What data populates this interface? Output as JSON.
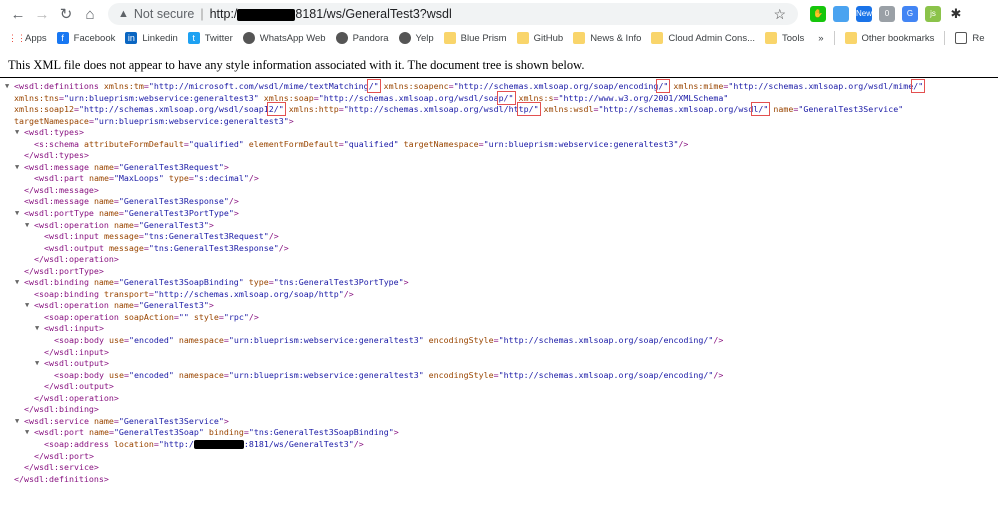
{
  "browser": {
    "address": {
      "security_label": "Not secure",
      "url_prefix": "http:/",
      "url_suffix": "8181/ws/GeneralTest3?wsdl"
    },
    "extensions": [
      {
        "name": "green-thumb",
        "color": "#16c60c",
        "text": "✋"
      },
      {
        "name": "window",
        "color": "#4aa3f0",
        "text": ""
      },
      {
        "name": "new-badge",
        "color": "#1a73e8",
        "text": "New"
      },
      {
        "name": "question",
        "color": "#9aa0a6",
        "text": "0"
      },
      {
        "name": "translate",
        "color": "#4285f4",
        "text": "G"
      },
      {
        "name": "js",
        "color": "#8bc34a",
        "text": "js"
      },
      {
        "name": "puzzle",
        "color": "#333",
        "text": "✱"
      }
    ],
    "bookmarks": [
      {
        "label": "Apps",
        "icon": "apps"
      },
      {
        "label": "Facebook",
        "icon": "facebook"
      },
      {
        "label": "Linkedin",
        "icon": "linkedin"
      },
      {
        "label": "Twitter",
        "icon": "twitter"
      },
      {
        "label": "WhatsApp Web",
        "icon": "globe"
      },
      {
        "label": "Pandora",
        "icon": "globe"
      },
      {
        "label": "Yelp",
        "icon": "globe"
      },
      {
        "label": "Blue Prism",
        "icon": "folder"
      },
      {
        "label": "GitHub",
        "icon": "folder"
      },
      {
        "label": "News & Info",
        "icon": "folder"
      },
      {
        "label": "Cloud Admin Cons...",
        "icon": "folder"
      },
      {
        "label": "Tools",
        "icon": "folder"
      }
    ],
    "overflow": "»",
    "other_bookmarks": "Other bookmarks",
    "reading_list": "Re"
  },
  "notice": "This XML file does not appear to have any style information associated with it. The document tree is shown below.",
  "lines": [
    {
      "i": 0,
      "x": 1,
      "s": [
        [
          "t",
          "<wsdl:definitions "
        ],
        [
          "a",
          "xmlns:tm"
        ],
        [
          "t",
          "="
        ],
        [
          "v",
          "\"http://microsoft.com/wsdl/mime/textMatching"
        ],
        [
          "m",
          "/\""
        ],
        [
          "a",
          " xmlns:soapenc"
        ],
        [
          "t",
          "="
        ],
        [
          "v",
          "\"http://schemas.xmlsoap.org/soap/encoding"
        ],
        [
          "m",
          "/\""
        ],
        [
          "a",
          " xmlns:mime"
        ],
        [
          "t",
          "="
        ],
        [
          "v",
          "\"http://schemas.xmlsoap.org/wsdl/mime"
        ],
        [
          "m",
          "/\""
        ]
      ]
    },
    {
      "i": 0,
      "s": [
        [
          "a",
          "xmlns:tns"
        ],
        [
          "t",
          "="
        ],
        [
          "v",
          "\"urn:blueprism:webservice:generaltest3\""
        ],
        [
          "a",
          " xmlns:soap"
        ],
        [
          "t",
          "="
        ],
        [
          "v",
          "\"http://schemas.xmlsoap.org/wsdl/soa"
        ],
        [
          "m",
          "p/\""
        ],
        [
          "a",
          " xmlns:s"
        ],
        [
          "t",
          "="
        ],
        [
          "v",
          "\"http://www.w3.org/2001/XMLSchema\""
        ]
      ]
    },
    {
      "i": 0,
      "s": [
        [
          "a",
          "xmlns:soap12"
        ],
        [
          "t",
          "="
        ],
        [
          "v",
          "\"http://schemas.xmlsoap.org/wsdl/soap1"
        ],
        [
          "m",
          "2/\""
        ],
        [
          "a",
          " xmlns:http"
        ],
        [
          "t",
          "="
        ],
        [
          "v",
          "\"http://schemas.xmlsoap.org/wsdl/ht"
        ],
        [
          "m",
          "tp/\""
        ],
        [
          "a",
          " xmlns:wsdl"
        ],
        [
          "t",
          "="
        ],
        [
          "v",
          "\"http://schemas.xmlsoap.org/wsd"
        ],
        [
          "m",
          "l/\""
        ],
        [
          "a",
          " name"
        ],
        [
          "t",
          "="
        ],
        [
          "v",
          "\"GeneralTest3Service\""
        ]
      ]
    },
    {
      "i": 0,
      "s": [
        [
          "a",
          "targetNamespace"
        ],
        [
          "t",
          "="
        ],
        [
          "v",
          "\"urn:blueprism:webservice:generaltest3\""
        ],
        [
          "t",
          ">"
        ]
      ]
    },
    {
      "i": 1,
      "x": 1,
      "s": [
        [
          "t",
          "<wsdl:types>"
        ]
      ]
    },
    {
      "i": 2,
      "s": [
        [
          "t",
          "<s:schema "
        ],
        [
          "a",
          "attributeFormDefault"
        ],
        [
          "t",
          "="
        ],
        [
          "v",
          "\"qualified\""
        ],
        [
          "a",
          " elementFormDefault"
        ],
        [
          "t",
          "="
        ],
        [
          "v",
          "\"qualified\""
        ],
        [
          "a",
          " targetNamespace"
        ],
        [
          "t",
          "="
        ],
        [
          "v",
          "\"urn:blueprism:webservice:generaltest3\""
        ],
        [
          "t",
          "/>"
        ]
      ]
    },
    {
      "i": 1,
      "s": [
        [
          "t",
          "</wsdl:types>"
        ]
      ]
    },
    {
      "i": 1,
      "x": 1,
      "s": [
        [
          "t",
          "<wsdl:message "
        ],
        [
          "a",
          "name"
        ],
        [
          "t",
          "="
        ],
        [
          "v",
          "\"GeneralTest3Request\""
        ],
        [
          "t",
          ">"
        ]
      ]
    },
    {
      "i": 2,
      "s": [
        [
          "t",
          "<wsdl:part "
        ],
        [
          "a",
          "name"
        ],
        [
          "t",
          "="
        ],
        [
          "v",
          "\"MaxLoops\""
        ],
        [
          "a",
          " type"
        ],
        [
          "t",
          "="
        ],
        [
          "v",
          "\"s:decimal\""
        ],
        [
          "t",
          "/>"
        ]
      ]
    },
    {
      "i": 1,
      "s": [
        [
          "t",
          "</wsdl:message>"
        ]
      ]
    },
    {
      "i": 1,
      "s": [
        [
          "t",
          "<wsdl:message "
        ],
        [
          "a",
          "name"
        ],
        [
          "t",
          "="
        ],
        [
          "v",
          "\"GeneralTest3Response\""
        ],
        [
          "t",
          "/>"
        ]
      ]
    },
    {
      "i": 1,
      "x": 1,
      "s": [
        [
          "t",
          "<wsdl:portType "
        ],
        [
          "a",
          "name"
        ],
        [
          "t",
          "="
        ],
        [
          "v",
          "\"GeneralTest3PortType\""
        ],
        [
          "t",
          ">"
        ]
      ]
    },
    {
      "i": 2,
      "x": 1,
      "s": [
        [
          "t",
          "<wsdl:operation "
        ],
        [
          "a",
          "name"
        ],
        [
          "t",
          "="
        ],
        [
          "v",
          "\"GeneralTest3\""
        ],
        [
          "t",
          ">"
        ]
      ]
    },
    {
      "i": 3,
      "s": [
        [
          "t",
          "<wsdl:input "
        ],
        [
          "a",
          "message"
        ],
        [
          "t",
          "="
        ],
        [
          "v",
          "\"tns:GeneralTest3Request\""
        ],
        [
          "t",
          "/>"
        ]
      ]
    },
    {
      "i": 3,
      "s": [
        [
          "t",
          "<wsdl:output "
        ],
        [
          "a",
          "message"
        ],
        [
          "t",
          "="
        ],
        [
          "v",
          "\"tns:GeneralTest3Response\""
        ],
        [
          "t",
          "/>"
        ]
      ]
    },
    {
      "i": 2,
      "s": [
        [
          "t",
          "</wsdl:operation>"
        ]
      ]
    },
    {
      "i": 1,
      "s": [
        [
          "t",
          "</wsdl:portType>"
        ]
      ]
    },
    {
      "i": 1,
      "x": 1,
      "s": [
        [
          "t",
          "<wsdl:binding "
        ],
        [
          "a",
          "name"
        ],
        [
          "t",
          "="
        ],
        [
          "v",
          "\"GeneralTest3SoapBinding\""
        ],
        [
          "a",
          " type"
        ],
        [
          "t",
          "="
        ],
        [
          "v",
          "\"tns:GeneralTest3PortType\""
        ],
        [
          "t",
          ">"
        ]
      ]
    },
    {
      "i": 2,
      "s": [
        [
          "t",
          "<soap:binding "
        ],
        [
          "a",
          "transport"
        ],
        [
          "t",
          "="
        ],
        [
          "v",
          "\"http://schemas.xmlsoap.org/soap/http\""
        ],
        [
          "t",
          "/>"
        ]
      ]
    },
    {
      "i": 2,
      "x": 1,
      "s": [
        [
          "t",
          "<wsdl:operation "
        ],
        [
          "a",
          "name"
        ],
        [
          "t",
          "="
        ],
        [
          "v",
          "\"GeneralTest3\""
        ],
        [
          "t",
          ">"
        ]
      ]
    },
    {
      "i": 3,
      "s": [
        [
          "t",
          "<soap:operation "
        ],
        [
          "a",
          "soapAction"
        ],
        [
          "t",
          "="
        ],
        [
          "v",
          "\"\""
        ],
        [
          "a",
          " style"
        ],
        [
          "t",
          "="
        ],
        [
          "v",
          "\"rpc\""
        ],
        [
          "t",
          "/>"
        ]
      ]
    },
    {
      "i": 3,
      "x": 1,
      "s": [
        [
          "t",
          "<wsdl:input>"
        ]
      ]
    },
    {
      "i": 4,
      "s": [
        [
          "t",
          "<soap:body "
        ],
        [
          "a",
          "use"
        ],
        [
          "t",
          "="
        ],
        [
          "v",
          "\"encoded\""
        ],
        [
          "a",
          " namespace"
        ],
        [
          "t",
          "="
        ],
        [
          "v",
          "\"urn:blueprism:webservice:generaltest3\""
        ],
        [
          "a",
          " encodingStyle"
        ],
        [
          "t",
          "="
        ],
        [
          "v",
          "\"http://schemas.xmlsoap.org/soap/encoding/\""
        ],
        [
          "t",
          "/>"
        ]
      ]
    },
    {
      "i": 3,
      "s": [
        [
          "t",
          "</wsdl:input>"
        ]
      ]
    },
    {
      "i": 3,
      "x": 1,
      "s": [
        [
          "t",
          "<wsdl:output>"
        ]
      ]
    },
    {
      "i": 4,
      "s": [
        [
          "t",
          "<soap:body "
        ],
        [
          "a",
          "use"
        ],
        [
          "t",
          "="
        ],
        [
          "v",
          "\"encoded\""
        ],
        [
          "a",
          " namespace"
        ],
        [
          "t",
          "="
        ],
        [
          "v",
          "\"urn:blueprism:webservice:generaltest3\""
        ],
        [
          "a",
          " encodingStyle"
        ],
        [
          "t",
          "="
        ],
        [
          "v",
          "\"http://schemas.xmlsoap.org/soap/encoding/\""
        ],
        [
          "t",
          "/>"
        ]
      ]
    },
    {
      "i": 3,
      "s": [
        [
          "t",
          "</wsdl:output>"
        ]
      ]
    },
    {
      "i": 2,
      "s": [
        [
          "t",
          "</wsdl:operation>"
        ]
      ]
    },
    {
      "i": 1,
      "s": [
        [
          "t",
          "</wsdl:binding>"
        ]
      ]
    },
    {
      "i": 1,
      "x": 1,
      "s": [
        [
          "t",
          "<wsdl:service "
        ],
        [
          "a",
          "name"
        ],
        [
          "t",
          "="
        ],
        [
          "v",
          "\"GeneralTest3Service\""
        ],
        [
          "t",
          ">"
        ]
      ]
    },
    {
      "i": 2,
      "x": 1,
      "s": [
        [
          "t",
          "<wsdl:port "
        ],
        [
          "a",
          "name"
        ],
        [
          "t",
          "="
        ],
        [
          "v",
          "\"GeneralTest3Soap\""
        ],
        [
          "a",
          " binding"
        ],
        [
          "t",
          "="
        ],
        [
          "v",
          "\"tns:GeneralTest3SoapBinding\""
        ],
        [
          "t",
          ">"
        ]
      ]
    },
    {
      "i": 3,
      "s": [
        [
          "t",
          "<soap:address "
        ],
        [
          "a",
          "location"
        ],
        [
          "t",
          "="
        ],
        [
          "v",
          "\"http:/"
        ],
        [
          "r",
          ""
        ],
        [
          "v",
          ":8181/ws/GeneralTest3\""
        ],
        [
          "t",
          "/>"
        ]
      ]
    },
    {
      "i": 2,
      "s": [
        [
          "t",
          "</wsdl:port>"
        ]
      ]
    },
    {
      "i": 1,
      "s": [
        [
          "t",
          "</wsdl:service>"
        ]
      ]
    },
    {
      "i": 0,
      "s": [
        [
          "t",
          "</wsdl:definitions>"
        ]
      ]
    }
  ]
}
